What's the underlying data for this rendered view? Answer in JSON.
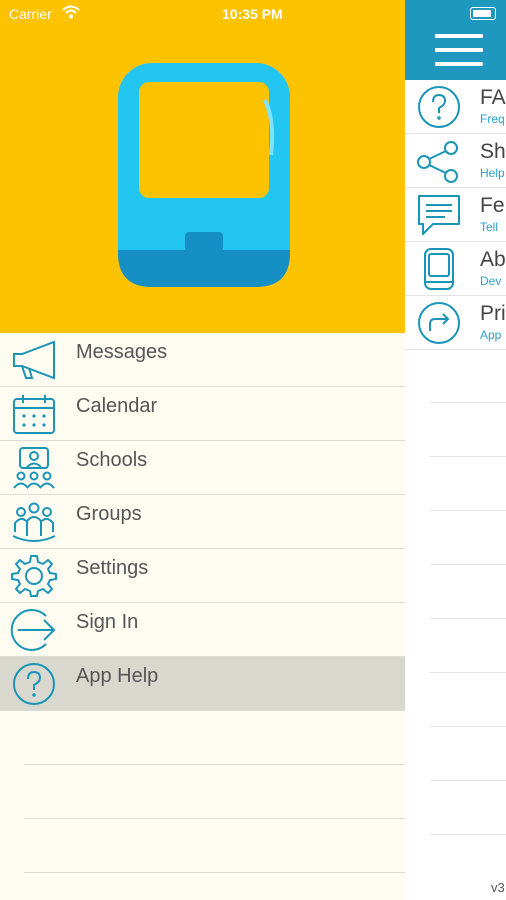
{
  "status_bar": {
    "carrier": "Carrier",
    "time": "10:35 PM"
  },
  "drawer": {
    "menu": [
      {
        "label": "Messages",
        "icon": "megaphone-icon"
      },
      {
        "label": "Calendar",
        "icon": "calendar-icon"
      },
      {
        "label": "Schools",
        "icon": "schools-icon"
      },
      {
        "label": "Groups",
        "icon": "groups-icon"
      },
      {
        "label": "Settings",
        "icon": "gear-icon"
      },
      {
        "label": "Sign In",
        "icon": "sign-in-icon"
      },
      {
        "label": "App Help",
        "icon": "help-icon"
      }
    ],
    "active_item": "App Help"
  },
  "help_panel": {
    "items": [
      {
        "title": "FA",
        "subtitle": "Freq",
        "icon": "help-icon"
      },
      {
        "title": "Sh",
        "subtitle": "Help",
        "icon": "share-icon"
      },
      {
        "title": "Fe",
        "subtitle": "Tell",
        "icon": "feedback-icon"
      },
      {
        "title": "Ab",
        "subtitle": "Dev",
        "icon": "device-icon"
      },
      {
        "title": "Pri",
        "subtitle": "App",
        "icon": "redirect-icon"
      }
    ],
    "version": "v3"
  },
  "colors": {
    "brand_yellow": "#fdc300",
    "accent_blue": "#1f98c0",
    "icon_blue": "#1a95b8"
  }
}
